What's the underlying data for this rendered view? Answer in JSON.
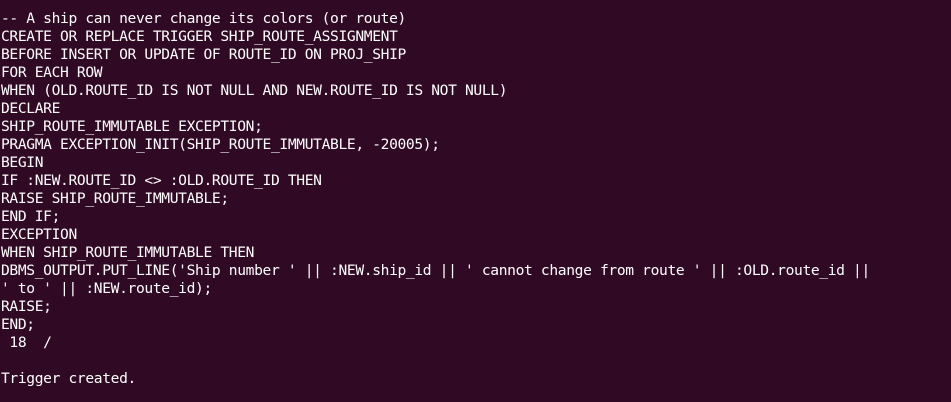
{
  "terminal": {
    "lines": [
      "-- A ship can never change its colors (or route)",
      "CREATE OR REPLACE TRIGGER SHIP_ROUTE_ASSIGNMENT",
      "BEFORE INSERT OR UPDATE OF ROUTE_ID ON PROJ_SHIP",
      "FOR EACH ROW",
      "WHEN (OLD.ROUTE_ID IS NOT NULL AND NEW.ROUTE_ID IS NOT NULL)",
      "DECLARE",
      "SHIP_ROUTE_IMMUTABLE EXCEPTION;",
      "PRAGMA EXCEPTION_INIT(SHIP_ROUTE_IMMUTABLE, -20005);",
      "BEGIN",
      "IF :NEW.ROUTE_ID <> :OLD.ROUTE_ID THEN",
      "RAISE SHIP_ROUTE_IMMUTABLE;",
      "END IF;",
      "EXCEPTION",
      "WHEN SHIP_ROUTE_IMMUTABLE THEN",
      "DBMS_OUTPUT.PUT_LINE('Ship number ' || :NEW.ship_id || ' cannot change from route ' || :OLD.route_id ||",
      "' to ' || :NEW.route_id);",
      "RAISE;",
      "END;",
      " 18  /",
      "",
      "Trigger created."
    ],
    "colors": {
      "background": "#300a24",
      "foreground": "#ffffff"
    }
  }
}
